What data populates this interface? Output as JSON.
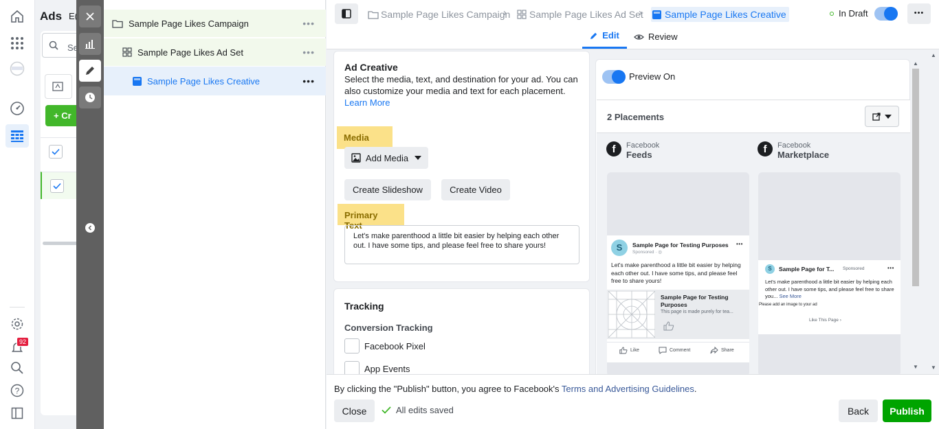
{
  "nav": {
    "notifications_count": "92"
  },
  "bg": {
    "ads_label": "Ads",
    "ads_label2": "E(",
    "search_placeholder": "Se",
    "create_label": "+ Cr"
  },
  "tree": {
    "campaign": "Sample Page Likes Campaign",
    "adset": "Sample Page Likes Ad Set",
    "creative": "Sample Page Likes Creative"
  },
  "header": {
    "crumb_campaign": "Sample Page Likes Campaign",
    "crumb_adset": "Sample Page Likes Ad Set",
    "crumb_creative": "Sample Page Likes Creative",
    "status": "In Draft",
    "tab_edit": "Edit",
    "tab_review": "Review"
  },
  "ad_creative": {
    "title": "Ad Creative",
    "description": "Select the media, text, and destination for your ad. You can also customize your media and text for each placement.",
    "learn_more": "Learn More",
    "media_label": "Media",
    "add_media": "Add Media",
    "create_slideshow": "Create Slideshow",
    "create_video": "Create Video",
    "primary_text_label": "Primary Text",
    "primary_text_value": "Let's make parenthood a little bit easier by helping each other out. I have some tips, and please feel free to share yours!"
  },
  "tracking": {
    "title": "Tracking",
    "conversion_label": "Conversion Tracking",
    "facebook_pixel": "Facebook Pixel",
    "app_events": "App Events"
  },
  "preview": {
    "toggle_label": "Preview On",
    "placements": "2 Placements",
    "feeds": {
      "platform": "Facebook",
      "name": "Feeds",
      "page_name": "Sample Page for Testing Purposes",
      "sponsored": "Sponsored · ◎",
      "text": "Let's make parenthood a little bit easier by helping each other out. I have some tips, and please feel free to share yours!",
      "link_title": "Sample Page for Testing Purposes",
      "link_desc": "This page is made purely for tea...",
      "like": "Like",
      "comment": "Comment",
      "share": "Share",
      "avatar_letter": "S"
    },
    "marketplace": {
      "platform": "Facebook",
      "name": "Marketplace",
      "page_name": "Sample Page for T...",
      "sponsored": "Sponsored",
      "text": "Let's make parenthood a little bit easier by helping each other out. I have some tips, and please feel free to share you...",
      "see_more": "See More",
      "image_note": "Please add an image to your ad",
      "like_page": "Like This Page",
      "avatar_letter": "S"
    }
  },
  "footer": {
    "agreement_prefix": "By clicking the \"Publish\" button, you agree to Facebook's ",
    "agreement_link": "Terms and Advertising Guidelines",
    "agreement_suffix": ".",
    "close": "Close",
    "saved": "All edits saved",
    "back": "Back",
    "publish": "Publish"
  },
  "colors": {
    "brand_blue": "#1877f2",
    "publish_green": "#00a400",
    "highlight_yellow": "#fbe189"
  }
}
